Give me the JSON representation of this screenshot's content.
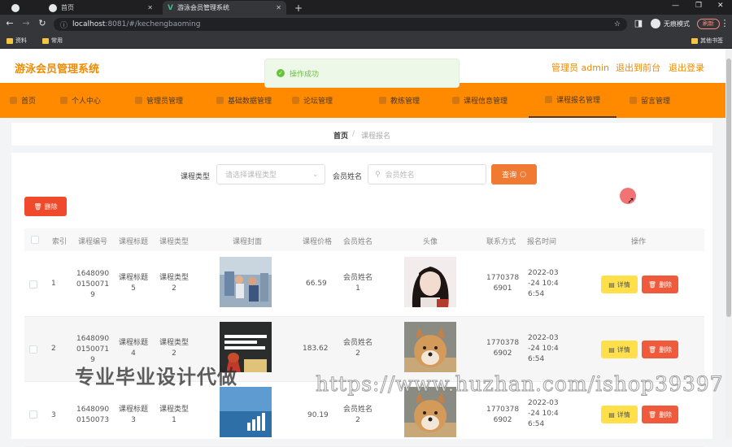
{
  "browser": {
    "tabs": [
      {
        "label": "首页",
        "active": false
      },
      {
        "label": "游泳会员管理系统",
        "active": true
      }
    ],
    "url_host": "localhost",
    "url_path": ":8081/#/kechengbaoming",
    "incognito_label": "无痕模式",
    "refresh_label": "刷新",
    "bookmarks": [
      "资料",
      "常用"
    ],
    "other_bookmarks": "其他书签"
  },
  "header": {
    "title": "游泳会员管理系统",
    "admin": "管理员 admin",
    "back_to_admin": "退出到前台",
    "logout": "退出登录"
  },
  "toast": {
    "message": "操作成功",
    "color": "#67c23a"
  },
  "nav": {
    "items": [
      {
        "label": "首页"
      },
      {
        "label": "个人中心"
      },
      {
        "label": "管理员管理"
      },
      {
        "label": "基础数据管理"
      },
      {
        "label": "论坛管理"
      },
      {
        "label": "教练管理"
      },
      {
        "label": "课程信息管理"
      },
      {
        "label": "课程报名管理"
      },
      {
        "label": "留言管理"
      }
    ],
    "color": "#ff8a00"
  },
  "breadcrumb": {
    "home": "首页",
    "current": "课程报名"
  },
  "search": {
    "course_type_label": "课程类型",
    "course_type_placeholder": "请选择课程类型",
    "member_name_label": "会员姓名",
    "member_name_placeholder": "会员姓名",
    "search_button": "查询"
  },
  "actions": {
    "delete_button": "删除"
  },
  "table": {
    "headers": [
      "索引",
      "课程编号",
      "课程标题",
      "课程类型",
      "课程封面",
      "课程价格",
      "会员姓名",
      "头像",
      "联系方式",
      "报名时间",
      "操作"
    ],
    "detail_label": "详情",
    "delete_label": "删除",
    "rows": [
      {
        "index": "1",
        "code": "1648090\n0150071\n9",
        "title": "课程标题\n5",
        "type": "课程类型\n2",
        "price": "66.59",
        "member": "会员姓名\n1",
        "phone": "1770378\n6901",
        "time": "2022-03\n-24 10:4\n6:54"
      },
      {
        "index": "2",
        "code": "1648090\n0150071\n9",
        "title": "课程标题\n4",
        "type": "课程类型\n2",
        "price": "183.62",
        "member": "会员姓名\n2",
        "phone": "1770378\n6902",
        "time": "2022-03\n-24 10:4\n6:54"
      },
      {
        "index": "3",
        "code": "1648090\n0150073",
        "title": "课程标题\n3",
        "type": "课程类型\n1",
        "price": "90.19",
        "member": "会员姓名\n2",
        "phone": "1770378\n6902",
        "time": "2022-03\n-24 10:4\n6:54"
      }
    ]
  },
  "watermark": {
    "left": "专业毕业设计代做",
    "right": "https://www.huzhan.com/ishop39397"
  }
}
